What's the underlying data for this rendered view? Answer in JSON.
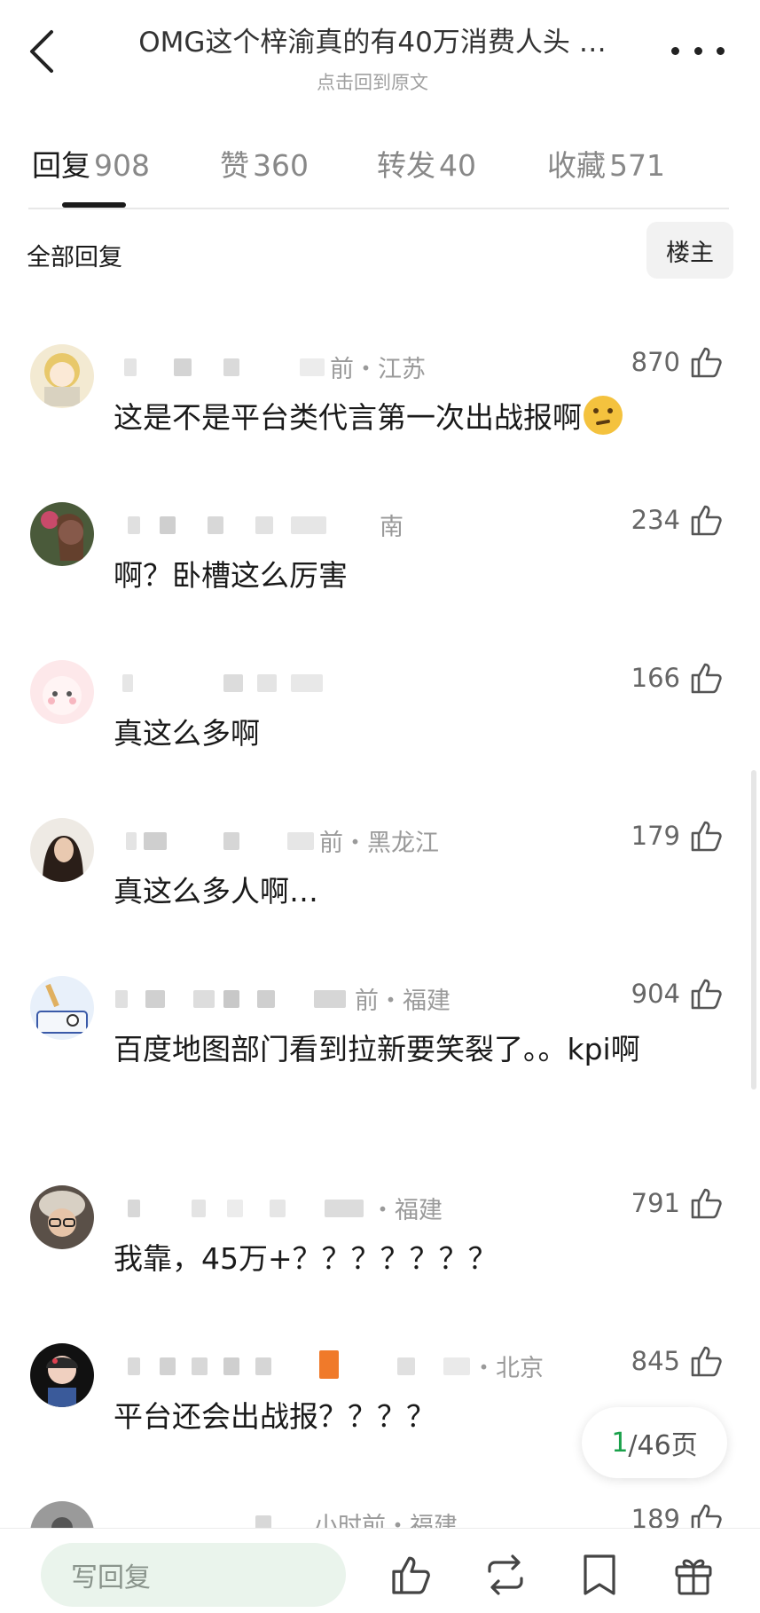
{
  "header": {
    "title": "OMG这个梓渝真的有40万消费人头 …",
    "subtitle": "点击回到原文"
  },
  "tabs": [
    {
      "label": "回复",
      "count": "908"
    },
    {
      "label": "赞",
      "count": "360"
    },
    {
      "label": "转发",
      "count": "40"
    },
    {
      "label": "收藏",
      "count": "571"
    }
  ],
  "filter": {
    "title": "全部回复",
    "op_button": "楼主"
  },
  "comments": [
    {
      "meta": "前・江苏",
      "likes": "870",
      "text": "这是不是平台类代言第一次出战报啊"
    },
    {
      "meta": "南",
      "likes": "234",
      "text": "啊？卧槽这么厉害"
    },
    {
      "meta": "",
      "likes": "166",
      "text": "真这么多啊"
    },
    {
      "meta": "前・黑龙江",
      "likes": "179",
      "text": "真这么多人啊…"
    },
    {
      "meta": "前・福建",
      "likes": "904",
      "text": "百度地图部门看到拉新要笑裂了。。kpi啊"
    },
    {
      "meta": "・福建",
      "likes": "791",
      "text": "我靠，45万+？？？？？？？"
    },
    {
      "meta": "・北京",
      "likes": "845",
      "text": "平台还会出战报？？？？"
    },
    {
      "meta": "小时前・福建",
      "likes": "189",
      "text": ""
    }
  ],
  "pagination": {
    "current": "1",
    "total_text": "/46页"
  },
  "bottom_bar": {
    "reply_placeholder": "写回复"
  },
  "colors": {
    "accent_green": "#1aa14b",
    "reply_bg": "#eaf4ec"
  }
}
